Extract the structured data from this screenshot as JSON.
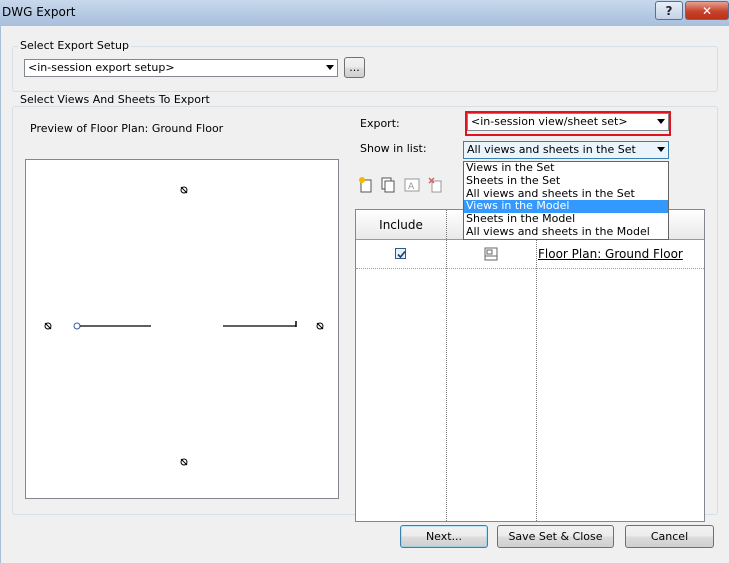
{
  "window": {
    "title": "DWG Export",
    "help_label": "?",
    "close_label": "✕"
  },
  "export_setup": {
    "group_label": "Select Export Setup",
    "selected": "<in-session export setup>",
    "browse_label": "..."
  },
  "views_group": {
    "label": "Select Views And Sheets To Export"
  },
  "preview": {
    "label": "Preview of Floor Plan: Ground Floor"
  },
  "export_field": {
    "label": "Export:",
    "selected": "<in-session view/sheet set>"
  },
  "show_in_list": {
    "label": "Show in list:",
    "selected": "All views and sheets in the Set",
    "options": [
      "Views in the Set",
      "Sheets in the Set",
      "All views and sheets in the Set",
      "Views in the Model",
      "Sheets in the Model",
      "All views and sheets in the Model"
    ],
    "highlighted_index": 3
  },
  "toolbar_icons": [
    "new-set-icon",
    "duplicate-icon",
    "rename-icon",
    "delete-icon"
  ],
  "table": {
    "columns": [
      "Include",
      "",
      ""
    ],
    "rows": [
      {
        "include": true,
        "name": "Floor Plan: Ground Floor"
      }
    ]
  },
  "buttons": {
    "next": "Next...",
    "save_close": "Save Set & Close",
    "cancel": "Cancel"
  },
  "colors": {
    "highlight_box": "#e0141e",
    "selection": "#3399ff",
    "link": "#000080"
  }
}
